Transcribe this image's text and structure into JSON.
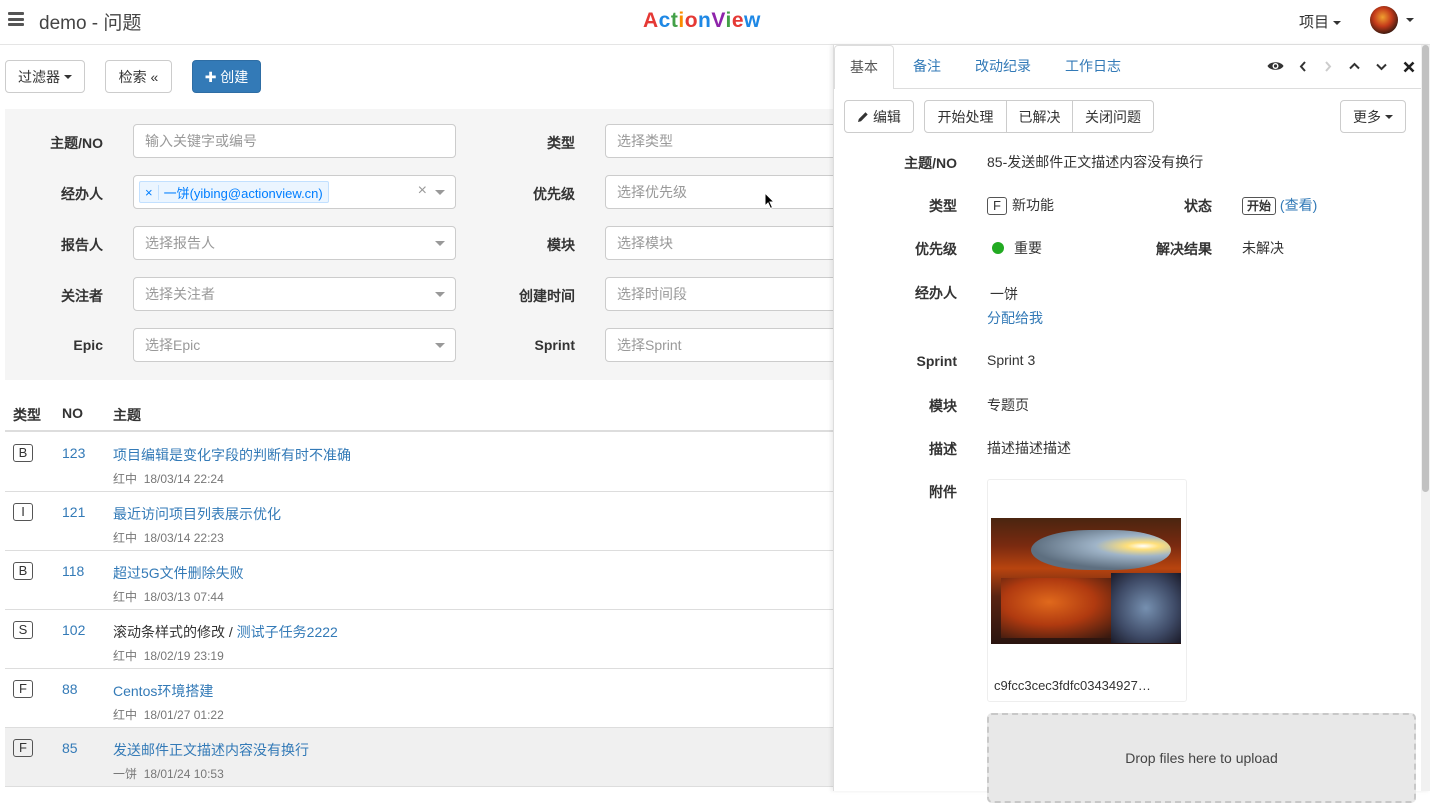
{
  "header": {
    "title": "demo - 问题",
    "brand": [
      "A",
      "c",
      "t",
      "i",
      "o",
      "n",
      "V",
      "i",
      "e",
      "w"
    ],
    "brand_colors": [
      "#e53935",
      "#1e88e5",
      "#43a047",
      "#fb8c00",
      "#e53935",
      "#1e88e5",
      "#8e24aa",
      "#43a047",
      "#e53935",
      "#1e88e5"
    ],
    "project_menu": "项目"
  },
  "toolbar": {
    "filter_label": "过滤器",
    "search_label": "检索 «",
    "create_label": "✚ 创建"
  },
  "filters": {
    "subject": {
      "label": "主题/NO",
      "placeholder": "输入关键字或编号"
    },
    "assignee": {
      "label": "经办人",
      "tag": "一饼(yibing@actionview.cn)",
      "tag_remove": "×",
      "clear": "×"
    },
    "reporter": {
      "label": "报告人",
      "placeholder": "选择报告人"
    },
    "watcher": {
      "label": "关注者",
      "placeholder": "选择关注者"
    },
    "epic": {
      "label": "Epic",
      "placeholder": "选择Epic"
    },
    "type": {
      "label": "类型",
      "placeholder": "选择类型"
    },
    "priority": {
      "label": "优先级",
      "placeholder": "选择优先级"
    },
    "module": {
      "label": "模块",
      "placeholder": "选择模块"
    },
    "created": {
      "label": "创建时间",
      "placeholder": "选择时间段"
    },
    "sprint": {
      "label": "Sprint",
      "placeholder": "选择Sprint"
    }
  },
  "table": {
    "headers": {
      "type": "类型",
      "no": "NO",
      "subject": "主题"
    },
    "rows": [
      {
        "type": "B",
        "no": "123",
        "title": "项目编辑是变化字段的判断有时不准确",
        "parent": "",
        "reporter": "红中",
        "time": "18/03/14 22:24"
      },
      {
        "type": "I",
        "no": "121",
        "title": "最近访问项目列表展示优化",
        "parent": "",
        "reporter": "红中",
        "time": "18/03/14 22:23"
      },
      {
        "type": "B",
        "no": "118",
        "title": "超过5G文件删除失败",
        "parent": "",
        "reporter": "红中",
        "time": "18/03/13 07:44"
      },
      {
        "type": "S",
        "no": "102",
        "title": "测试子任务2222",
        "parent": "滚动条样式的修改 / ",
        "reporter": "红中",
        "time": "18/02/19 23:19"
      },
      {
        "type": "F",
        "no": "88",
        "title": "Centos环境搭建",
        "parent": "",
        "reporter": "红中",
        "time": "18/01/27 01:22"
      },
      {
        "type": "F",
        "no": "85",
        "title": "发送邮件正文描述内容没有换行",
        "parent": "",
        "reporter": "一饼",
        "time": "18/01/24 10:53"
      }
    ]
  },
  "detail": {
    "tabs": [
      "基本",
      "备注",
      "改动纪录",
      "工作日志"
    ],
    "actions": {
      "edit": "编辑",
      "start": "开始处理",
      "resolved": "已解决",
      "close": "关闭问题",
      "more": "更多"
    },
    "fields": {
      "subject_label": "主题/NO",
      "subject": "85-发送邮件正文描述内容没有换行",
      "type_label": "类型",
      "type_badge": "F",
      "type": "新功能",
      "status_label": "状态",
      "status": "开始",
      "status_link": "(查看)",
      "priority_label": "优先级",
      "priority": "重要",
      "priority_color": "#22aa22",
      "resolution_label": "解决结果",
      "resolution": "未解决",
      "assignee_label": "经办人",
      "assignee": "一饼",
      "assign_me": "分配给我",
      "sprint_label": "Sprint",
      "sprint": "Sprint 3",
      "module_label": "模块",
      "module": "专题页",
      "desc_label": "描述",
      "desc": "描述描述描述",
      "attach_label": "附件",
      "attach_name": "c9fcc3cec3fdfc03434927…",
      "upload_text": "Drop files here to upload"
    }
  }
}
